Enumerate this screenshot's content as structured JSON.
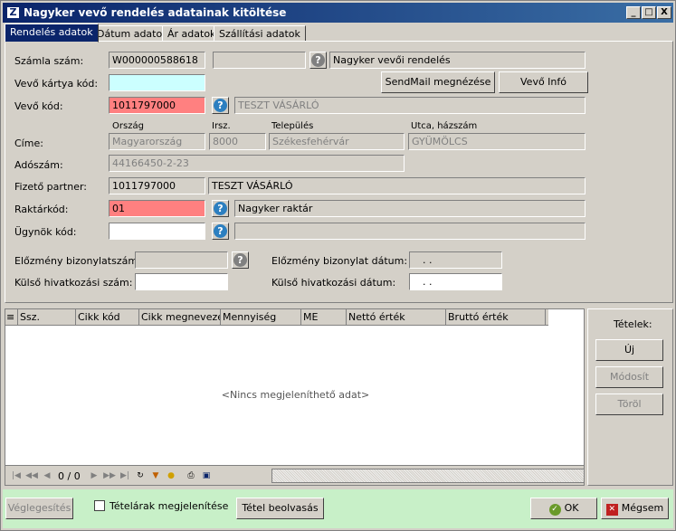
{
  "window": {
    "title": "Nagyker vevő rendelés adatainak kitöltése",
    "app_icon": "Z",
    "min": "_",
    "max": "□",
    "close": "X"
  },
  "tabs": [
    {
      "label": "Rendelés adatok",
      "active": true
    },
    {
      "label": "Dátum adatok"
    },
    {
      "label": "Ár adatok"
    },
    {
      "label": "Szállítási adatok"
    }
  ],
  "form": {
    "szamla_label": "Számla szám:",
    "szamla_value": "W000000588618",
    "szamla_type": "Nagyker vevői rendelés",
    "vevokartya_label": "Vevő kártya kód:",
    "vevokartya_value": "",
    "sendmail_label": "SendMail megnézése",
    "vevoinfo_label": "Vevő Infó",
    "vevokod_label": "Vevő kód:",
    "vevokod_value": "1011797000",
    "vevokod_name": "TESZT VÁSÁRLÓ",
    "cim_label": "Címe:",
    "orszag_hdr": "Ország",
    "irsz_hdr": "Irsz.",
    "telepules_hdr": "Település",
    "utca_hdr": "Utca, házszám",
    "orszag_value": "Magyarország",
    "irsz_value": "8000",
    "telepules_value": "Székesfehérvár",
    "utca_value": "GYÜMÖLCS",
    "adoszam_label": "Adószám:",
    "adoszam_value": "44166450-2-23",
    "fizeto_label": "Fizető partner:",
    "fizeto_value": "1011797000",
    "fizeto_name": "TESZT VÁSÁRLÓ",
    "raktar_label": "Raktárkód:",
    "raktar_value": "01",
    "raktar_name": "Nagyker raktár",
    "ugynok_label": "Ügynök kód:",
    "ugynok_value": "",
    "ugynok_name": "",
    "elozmeny_label": "Előzmény bizonylatszám:",
    "elozmeny_value": "",
    "elozmeny_datum_label": "Előzmény bizonylat dátum:",
    "elozmeny_datum_value": ". .",
    "kulso_label": "Külső hivatkozási szám:",
    "kulso_value": "",
    "kulso_datum_label": "Külső hivatkozási dátum:",
    "kulso_datum_value": ". ."
  },
  "grid": {
    "columns": [
      "Ssz.",
      "Cikk kód",
      "Cikk megnevezés",
      "Mennyiség",
      "ME",
      "Nettó érték",
      "Bruttó érték"
    ],
    "empty_text": "<Nincs megjeleníthető adat>",
    "page_indicator": "0 / 0"
  },
  "items_panel": {
    "title": "Tételek:",
    "new": "Új",
    "modify": "Módosít",
    "delete": "Töröl"
  },
  "footer": {
    "finalize": "Véglegesítés",
    "show_prices": "Tételárak megjelenítése",
    "scan": "Tétel beolvasás",
    "ok": "OK",
    "cancel": "Mégsem"
  },
  "colors": {
    "required": "#ff8080",
    "focus": "#ccffff",
    "footer": "#c8f0c8",
    "title": "#0a246a"
  }
}
